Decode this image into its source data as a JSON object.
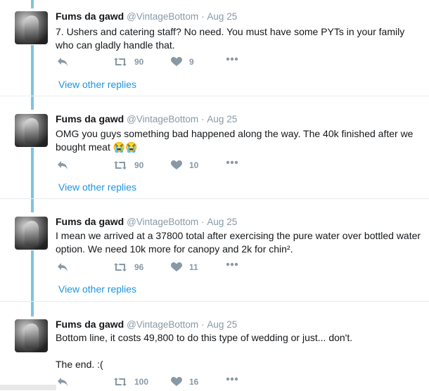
{
  "tweets": [
    {
      "name": "Fums da gawd",
      "handle": "@VintageBottom",
      "separator": "·",
      "time": "Aug 25",
      "text": "7. Ushers and catering staff? No need. You must have some PYTs in your family who can gladly handle that.",
      "retweets": "90",
      "likes": "9",
      "view_other": "View other replies"
    },
    {
      "name": "Fums da gawd",
      "handle": "@VintageBottom",
      "separator": "·",
      "time": "Aug 25",
      "text": "OMG you guys something bad happened along the way. The 40k finished after we bought meat 😭😭",
      "retweets": "90",
      "likes": "10",
      "view_other": "View other replies"
    },
    {
      "name": "Fums da gawd",
      "handle": "@VintageBottom",
      "separator": "·",
      "time": "Aug 25",
      "text": "I mean we arrived at a 37800 total after exercising the pure water over bottled water option. We need 10k more for canopy and 2k for chin².",
      "retweets": "96",
      "likes": "11",
      "view_other": "View other replies"
    },
    {
      "name": "Fums da gawd",
      "handle": "@VintageBottom",
      "separator": "·",
      "time": "Aug 25",
      "text": "Bottom line, it costs 49,800 to do this type of wedding or just... don't.",
      "text2": "The end. :(",
      "retweets": "100",
      "likes": "16"
    }
  ],
  "icons": {
    "reply": "reply-icon",
    "retweet": "retweet-icon",
    "like": "heart-icon",
    "more": "more-icon"
  },
  "colors": {
    "thread": "#7fc3e0",
    "link": "#1b95e0",
    "muted": "#8899a6"
  }
}
